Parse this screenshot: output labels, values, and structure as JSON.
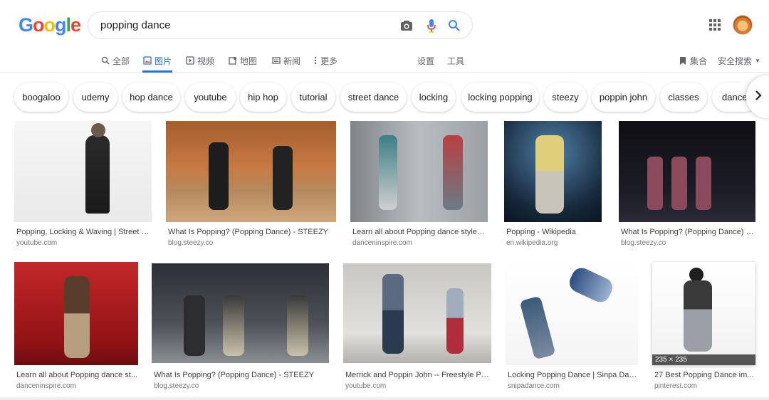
{
  "logo": {
    "letters": [
      "G",
      "o",
      "o",
      "g",
      "l",
      "e"
    ],
    "colors": [
      "#4285F4",
      "#EA4335",
      "#FBBC05",
      "#4285F4",
      "#34A853",
      "#EA4335"
    ]
  },
  "search": {
    "query": "popping dance"
  },
  "nav": {
    "all": "全部",
    "images": "图片",
    "videos": "视频",
    "maps": "地图",
    "news": "新闻",
    "more": "更多",
    "settings": "设置",
    "tools": "工具",
    "collections": "集合",
    "safe_search": "安全搜索"
  },
  "chips": [
    "boogaloo",
    "udemy",
    "hop dance",
    "youtube",
    "hip hop",
    "tutorial",
    "street dance",
    "locking",
    "locking popping",
    "steezy",
    "poppin john",
    "classes",
    "dance i"
  ],
  "results": [
    {
      "title": "Popping, Locking & Waving | Street D...",
      "domain": "youtube.com"
    },
    {
      "title": "What Is Popping? (Popping Dance) - STEEZY",
      "domain": "blog.steezy.co"
    },
    {
      "title": "Learn all about Popping dance style |...",
      "domain": "danceninspire.com"
    },
    {
      "title": "Popping - Wikipedia",
      "domain": "en.wikipedia.org"
    },
    {
      "title": "What Is Popping? (Popping Dance) - ...",
      "domain": "blog.steezy.co"
    },
    {
      "title": "Learn all about Popping dance st...",
      "domain": "danceninspire.com"
    },
    {
      "title": "What Is Popping? (Popping Dance) - STEEZY",
      "domain": "blog.steezy.co"
    },
    {
      "title": "Merrick and Poppin John -- Freestyle Po...",
      "domain": "youtube.com"
    },
    {
      "title": "Locking Popping Dance | Sinpa Dan...",
      "domain": "snipadance.com"
    },
    {
      "title": "27 Best Popping Dance im...",
      "domain": "pinterest.com",
      "badge": "235 × 235"
    }
  ],
  "colors": {
    "accent": "#1a73e8",
    "text_muted": "#70757a"
  }
}
